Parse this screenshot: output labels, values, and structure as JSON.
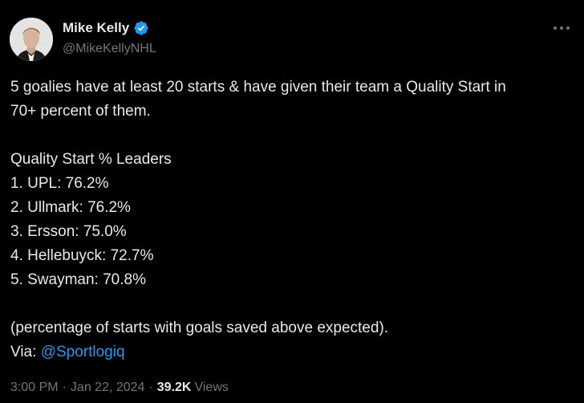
{
  "author": {
    "display_name": "Mike Kelly",
    "handle": "@MikeKellyNHL",
    "avatar_icon": "person-photo",
    "verified_icon": "verified-badge-icon",
    "verified_color": "#1d9bf0"
  },
  "more_icon": "more-horizontal-icon",
  "tweet": {
    "intro_line1": "5 goalies have at least 20 starts & have given their team a Quality Start in",
    "intro_line2": "70+ percent of them.",
    "list_title": "Quality Start % Leaders",
    "leaders": [
      "1. UPL: 76.2%",
      "2. Ullmark: 76.2%",
      "3. Ersson: 75.0%",
      "4. Hellebuyck: 72.7%",
      "5. Swayman: 70.8%"
    ],
    "note": "(percentage of starts with goals saved above expected).",
    "via_label": "Via:",
    "via_link": "@Sportlogiq"
  },
  "meta": {
    "time": "3:00 PM",
    "date": "Jan 22, 2024",
    "separator": "·",
    "views_count": "39.2K",
    "views_label": "Views"
  },
  "colors": {
    "background": "#000000",
    "text": "#e7e9ea",
    "muted": "#71767b",
    "link": "#1d9bf0"
  }
}
